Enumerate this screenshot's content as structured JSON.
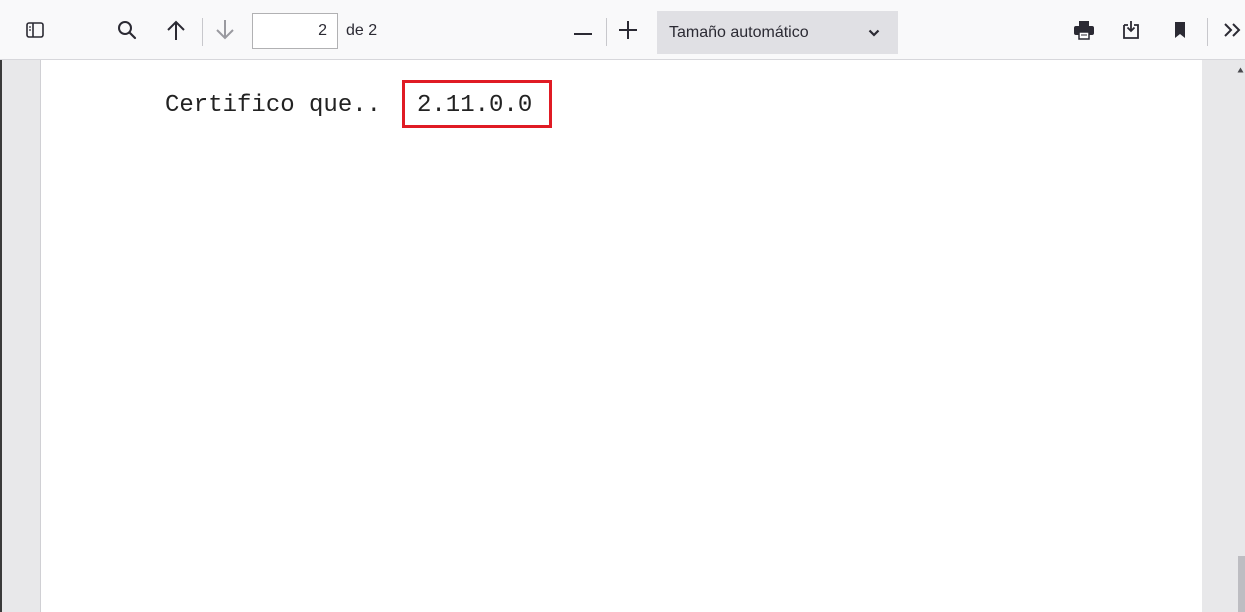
{
  "toolbar": {
    "sidebar_icon": "sidebar-toggle-icon",
    "search_icon": "search-icon",
    "prev_icon": "arrow-up-icon",
    "next_icon": "arrow-down-icon",
    "page_number": "2",
    "page_count": "de 2",
    "zoom_out_icon": "minus-icon",
    "zoom_in_icon": "plus-icon",
    "zoom_value": "Tamaño automático",
    "print_icon": "printer-icon",
    "save_icon": "download-icon",
    "bookmark_icon": "bookmark-icon",
    "more_icon": "double-chevron-right-icon"
  },
  "document": {
    "certificate_text": "Certifico que..",
    "version": "2.11.0.0"
  },
  "colors": {
    "highlight": "#e01b24",
    "toolbar_bg": "#f9f9fa",
    "zoom_bg": "#e0e0e4"
  }
}
